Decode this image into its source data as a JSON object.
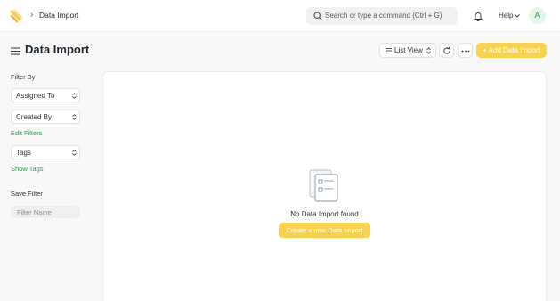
{
  "navbar": {
    "breadcrumb": "Data Import",
    "search_placeholder": "Search or type a command (Ctrl + G)",
    "help_label": "Help",
    "avatar_initial": "A"
  },
  "page": {
    "title": "Data Import",
    "view_selector_label": "List View",
    "primary_action_label": "+ Add Data Import"
  },
  "sidebar": {
    "filter_by_label": "Filter By",
    "filters": [
      "Assigned To",
      "Created By"
    ],
    "edit_filters_label": "Edit Filters",
    "tags_label": "Tags",
    "show_tags_label": "Show Tags",
    "save_filter_label": "Save Filter",
    "filter_name_placeholder": "Filter Name"
  },
  "main": {
    "empty_message": "No Data Import found",
    "create_button_label": "Create a new Data Import"
  },
  "colors": {
    "accent": "#f9d24c",
    "link_green": "#2e9e56",
    "avatar_bg": "#e4f5e9"
  }
}
